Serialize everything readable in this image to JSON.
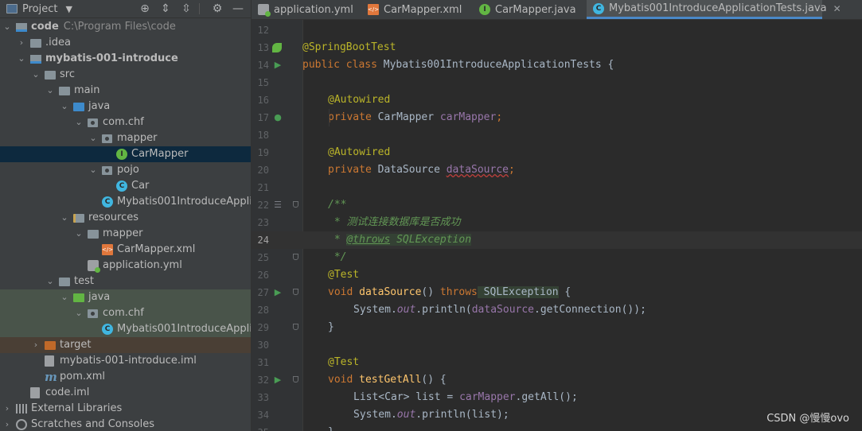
{
  "project_panel": {
    "title": "Project",
    "tree": [
      {
        "label": "code",
        "path": "C:\\Program Files\\code",
        "bold": true
      },
      {
        "label": ".idea"
      },
      {
        "label": "mybatis-001-introduce",
        "bold": true
      },
      {
        "label": "src"
      },
      {
        "label": "main"
      },
      {
        "label": "java"
      },
      {
        "label": "com.chf"
      },
      {
        "label": "mapper"
      },
      {
        "label": "CarMapper"
      },
      {
        "label": "pojo"
      },
      {
        "label": "Car"
      },
      {
        "label": "Mybatis001IntroduceApplicat"
      },
      {
        "label": "resources"
      },
      {
        "label": "mapper"
      },
      {
        "label": "CarMapper.xml"
      },
      {
        "label": "application.yml"
      },
      {
        "label": "test"
      },
      {
        "label": "java"
      },
      {
        "label": "com.chf"
      },
      {
        "label": "Mybatis001IntroduceApplicat"
      },
      {
        "label": "target"
      },
      {
        "label": "mybatis-001-introduce.iml"
      },
      {
        "label": "pom.xml"
      },
      {
        "label": "code.iml"
      },
      {
        "label": "External Libraries"
      },
      {
        "label": "Scratches and Consoles"
      }
    ]
  },
  "tabs": [
    {
      "label": "application.yml",
      "icon": "yaml-file-icon"
    },
    {
      "label": "CarMapper.xml",
      "icon": "xml-file-icon"
    },
    {
      "label": "CarMapper.java",
      "icon": "interface-icon"
    },
    {
      "label": "Mybatis001IntroduceApplicationTests.java",
      "icon": "class-icon",
      "active": true
    }
  ],
  "editor": {
    "lines": [
      {
        "n": "12"
      },
      {
        "n": "13",
        "t1": "@SpringBootTest"
      },
      {
        "n": "14",
        "t1": "public class",
        "t2": " Mybatis001IntroduceApplicationTests {"
      },
      {
        "n": "15"
      },
      {
        "n": "16",
        "t1": "@Autowired"
      },
      {
        "n": "17",
        "t1": "private",
        "t2": " CarMapper ",
        "t3": "carMapper",
        "t4": ";"
      },
      {
        "n": "18"
      },
      {
        "n": "19",
        "t1": "@Autowired"
      },
      {
        "n": "20",
        "t1": "private",
        "t2": " DataSource ",
        "t3": "dataSource",
        "t4": ";"
      },
      {
        "n": "21"
      },
      {
        "n": "22",
        "t1": "/**"
      },
      {
        "n": "23",
        "t1": " * 测试连接数据库是否成功"
      },
      {
        "n": "24",
        "t1": " * ",
        "t2": "@throws",
        "t3": " SQLException"
      },
      {
        "n": "25",
        "t1": " */"
      },
      {
        "n": "26",
        "t1": "@Test"
      },
      {
        "n": "27",
        "t1": "void",
        "t2": " dataSource",
        "t3": "() ",
        "t4": "throws",
        "t5": " SQLException",
        "t6": " {"
      },
      {
        "n": "28",
        "t1": "System.",
        "t2": "out",
        "t3": ".println(",
        "t4": "dataSource",
        "t5": ".getConnection());"
      },
      {
        "n": "29",
        "t1": "}"
      },
      {
        "n": "30"
      },
      {
        "n": "31",
        "t1": "@Test"
      },
      {
        "n": "32",
        "t1": "void",
        "t2": " testGetAll",
        "t3": "() {"
      },
      {
        "n": "33",
        "t1": "List<Car> list = ",
        "t2": "carMapper",
        "t3": ".getAll();"
      },
      {
        "n": "34",
        "t1": "System.",
        "t2": "out",
        "t3": ".println(list);"
      },
      {
        "n": "35",
        "t1": "}"
      }
    ]
  },
  "watermark": "CSDN @慢慢ovo",
  "colors": {
    "keyword": "#cc7832",
    "annotation": "#bbb529",
    "field": "#9876aa",
    "method": "#ffc66d",
    "doc": "#629755"
  }
}
